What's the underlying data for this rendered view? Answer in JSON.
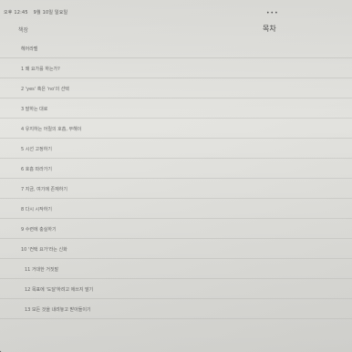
{
  "status_bar": {
    "time": "오후 12:45",
    "date": "9월 10일 일요일"
  },
  "nav": {
    "back_label": "책장",
    "title": "목차"
  },
  "toc": {
    "items": [
      "헤어라벨",
      "1 왜 요가를 하는가?",
      "2 'yes' 혹은 'no'의 선택",
      "3 말하는 대로",
      "4 유지하는 어릴의 호흡, 무해이",
      "5 시선 고정하기",
      "6 호흡 따라가기",
      "7 지금, 여기에 존재하기",
      "8 다시 시작하기",
      "9 수련에 충실하기",
      "10 '컨택 요가'라는 신화",
      "11 거대한 거짓말",
      "12 목표에 '도달'하려고 애쓰지 말기",
      "13 모든 것을 내려놓고 받아들이기"
    ]
  }
}
